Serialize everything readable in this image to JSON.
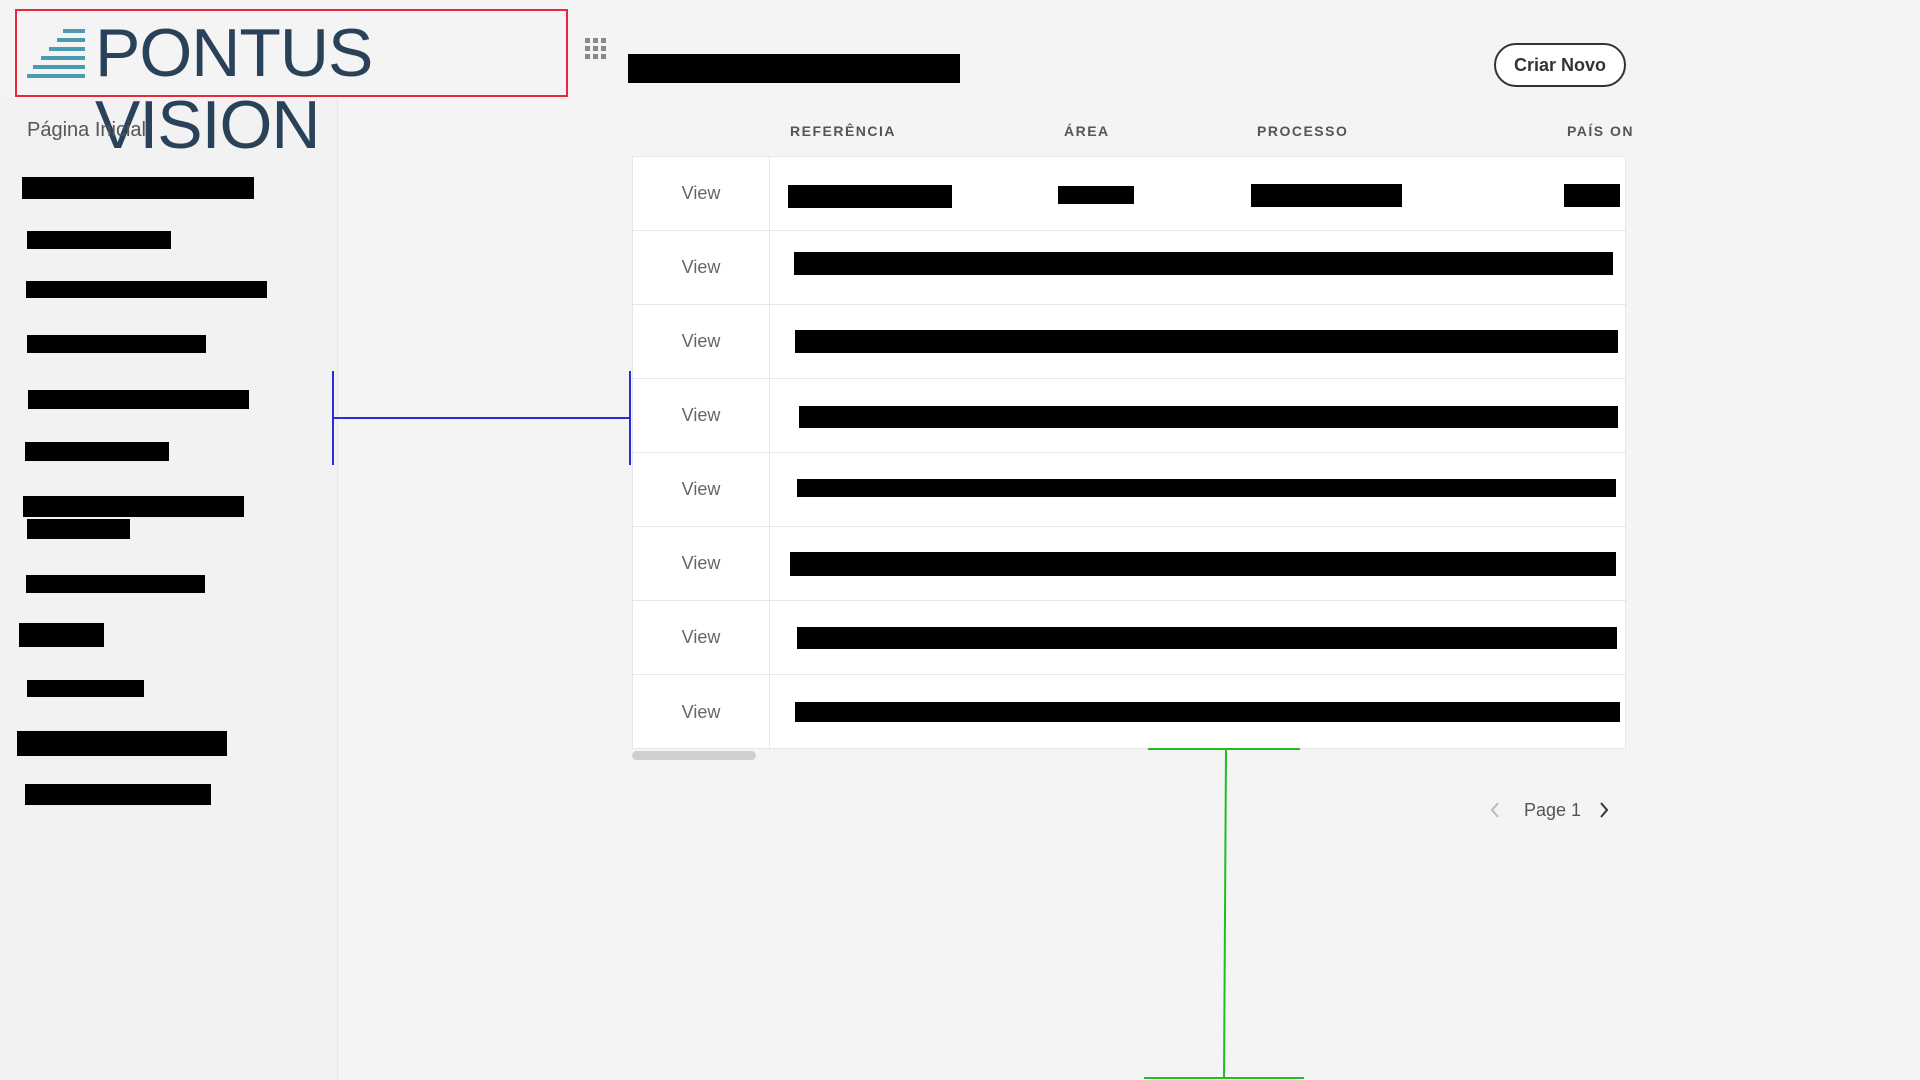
{
  "brand": {
    "logo_text": "PONTUS VISION",
    "accent": "#4a9bb0",
    "text_color": "#2a4259"
  },
  "header": {
    "title": "",
    "create_button": "Criar Novo"
  },
  "sidebar": {
    "home": "Página Inicial"
  },
  "table": {
    "columns": [
      "REFERÊNCIA",
      "ÁREA",
      "PROCESSO",
      "PAÍS ON"
    ],
    "rows": [
      {
        "action": "View"
      },
      {
        "action": "View"
      },
      {
        "action": "View"
      },
      {
        "action": "View"
      },
      {
        "action": "View"
      },
      {
        "action": "View"
      },
      {
        "action": "View"
      },
      {
        "action": "View"
      }
    ]
  },
  "pagination": {
    "label": "Page 1"
  },
  "icons": {
    "apps": "apps-grid-icon",
    "prev": "chevron-left-icon",
    "next": "chevron-right-icon",
    "logo": "stair-lines-icon"
  },
  "annotation_colors": {
    "red": "#e8283c",
    "blue": "#2b2bd6",
    "green": "#1fbf1f"
  }
}
